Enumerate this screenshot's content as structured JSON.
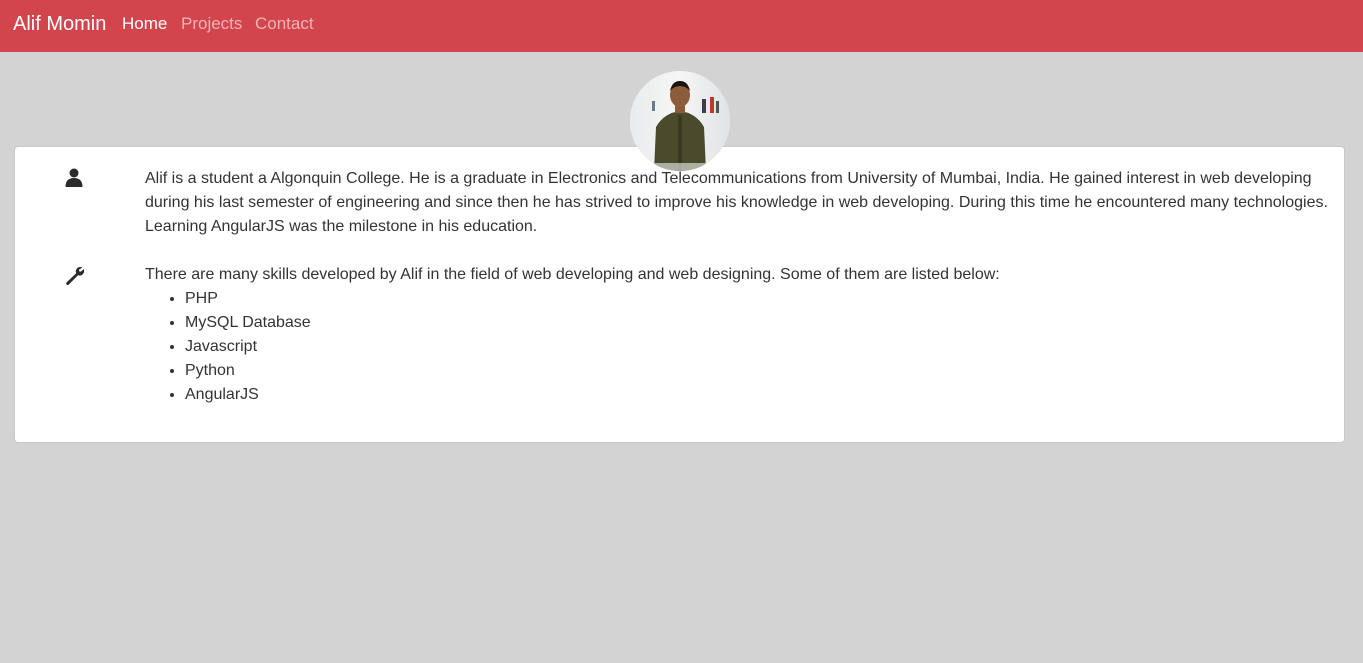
{
  "navbar": {
    "brand": "Alif Momin",
    "links": [
      {
        "label": "Home",
        "active": true
      },
      {
        "label": "Projects",
        "active": false
      },
      {
        "label": "Contact",
        "active": false
      }
    ]
  },
  "profile": {
    "avatar_icon": "profile-photo"
  },
  "about": {
    "icon": "user-icon",
    "text": "Alif is a student a Algonquin College. He is a graduate in Electronics and Telecommunications from University of Mumbai, India. He gained interest in web developing during his last semester of engineering and since then he has strived to improve his knowledge in web developing. During this time he encountered many technologies. Learning AngularJS was the milestone in his education."
  },
  "skills": {
    "icon": "wrench-icon",
    "intro": "There are many skills developed by Alif in the field of web developing and web designing. Some of them are listed below:",
    "items": [
      "PHP",
      "MySQL Database",
      "Javascript",
      "Python",
      "AngularJS"
    ]
  },
  "colors": {
    "navbar": "#d3454c",
    "background": "#d3d3d3",
    "card": "#ffffff",
    "text": "#333333"
  }
}
